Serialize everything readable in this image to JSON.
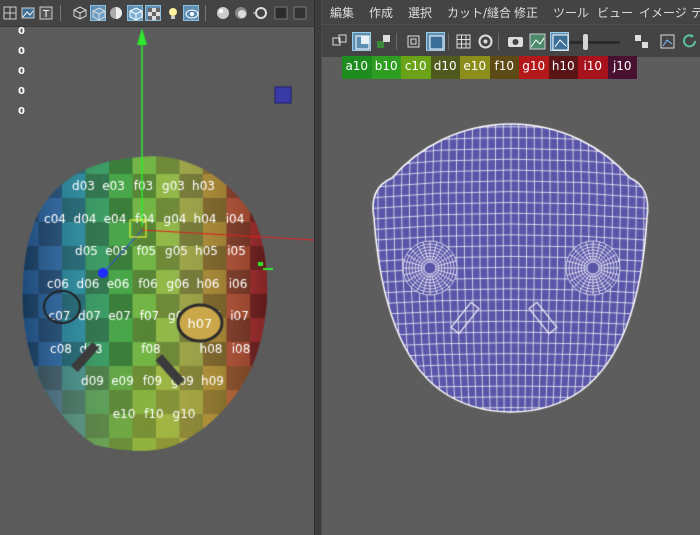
{
  "viewport": {
    "hud_values": [
      "0",
      "0",
      "0",
      "0",
      "0"
    ],
    "toolbar_icons": [
      "grid-view-icon",
      "image-plane-icon",
      "text-icon",
      "separator",
      "wireframe-cube-icon",
      "shaded-cube-icon",
      "smooth-shade-icon",
      "xray-cube-icon",
      "textured-cube-icon",
      "light-icon",
      "isolate-icon",
      "separator",
      "sphere-icon",
      "ambient-occlusion-icon",
      "motion-blur-icon",
      "aa-icon",
      "gamma-icon"
    ],
    "mask_labels": [
      {
        "text": "d03"
      },
      {
        "text": "e03"
      },
      {
        "text": "f03"
      },
      {
        "text": "g03"
      },
      {
        "text": "h03"
      },
      {
        "text": "c04"
      },
      {
        "text": "d04"
      },
      {
        "text": "e04"
      },
      {
        "text": "f04"
      },
      {
        "text": "g04"
      },
      {
        "text": "h04"
      },
      {
        "text": "i04"
      },
      {
        "text": "d05"
      },
      {
        "text": "e05"
      },
      {
        "text": "f05"
      },
      {
        "text": "g05"
      },
      {
        "text": "h05"
      },
      {
        "text": "i05"
      },
      {
        "text": "c06"
      },
      {
        "text": "d06"
      },
      {
        "text": "e06"
      },
      {
        "text": "f06"
      },
      {
        "text": "g06"
      },
      {
        "text": "h06"
      },
      {
        "text": "i06"
      },
      {
        "text": "c07"
      },
      {
        "text": "d07"
      },
      {
        "text": "e07"
      },
      {
        "text": "f07"
      },
      {
        "text": "g07"
      },
      {
        "text": "h07"
      },
      {
        "text": "i07"
      },
      {
        "text": "c08"
      },
      {
        "text": "d08"
      },
      {
        "text": "f08"
      },
      {
        "text": "h08"
      },
      {
        "text": "i08"
      },
      {
        "text": "d09"
      },
      {
        "text": "e09"
      },
      {
        "text": "f09"
      },
      {
        "text": "g09"
      },
      {
        "text": "h09"
      },
      {
        "text": "e10"
      },
      {
        "text": "f10"
      },
      {
        "text": "g10"
      }
    ]
  },
  "uv_editor": {
    "menu": [
      "編集",
      "作成",
      "選択",
      "カット/縫合",
      "修正",
      "ツール",
      "ビュー",
      "イメージ",
      "テ"
    ],
    "toolbar_icons": [
      "shell-icon",
      "uv-frame-icon",
      "checker-toggle-icon",
      "separator",
      "uv-border-icon",
      "uv-shell-border-icon",
      "separator",
      "grid-icon",
      "pixel-snap-icon",
      "separator",
      "snapshot-icon",
      "image-display-icon",
      "dim-image-icon",
      "exposure-slider",
      "checker-icon",
      "image-ratio-icon",
      "refresh-icon"
    ],
    "exposure_level": 0.45,
    "color_strip": [
      {
        "label": "a10",
        "color": "#1e8c1e"
      },
      {
        "label": "b10",
        "color": "#2f9c22"
      },
      {
        "label": "c10",
        "color": "#6aa318"
      },
      {
        "label": "d10",
        "color": "#4f5a1e"
      },
      {
        "label": "e10",
        "color": "#8c8e1c"
      },
      {
        "label": "f10",
        "color": "#5e4a14"
      },
      {
        "label": "g10",
        "color": "#b4181a"
      },
      {
        "label": "h10",
        "color": "#5a1416"
      },
      {
        "label": "i10",
        "color": "#a8121c"
      },
      {
        "label": "j10",
        "color": "#4a1030"
      }
    ],
    "uv_fill_color": "#5a55a8"
  }
}
